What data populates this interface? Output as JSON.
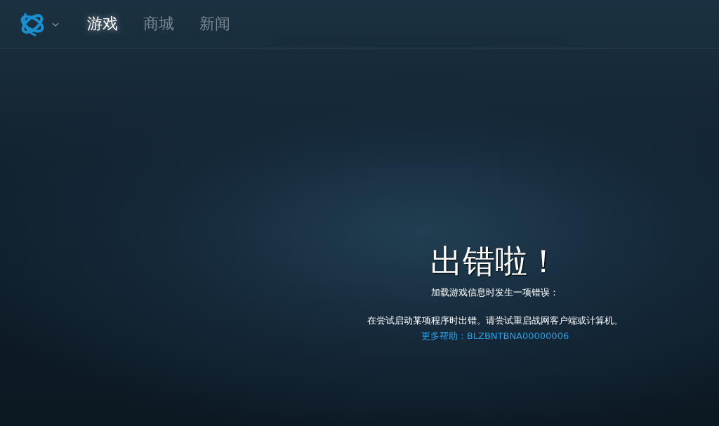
{
  "nav": {
    "tabs": [
      {
        "label": "游戏",
        "selected": true
      },
      {
        "label": "商城",
        "selected": false
      },
      {
        "label": "新闻",
        "selected": false
      }
    ]
  },
  "error": {
    "title": "出错啦！",
    "subtitle": "加载游戏信息时发生一项错误：",
    "message": "在尝试启动某项程序时出错。请尝试重启战网客户端或计算机。",
    "help_link": "更多帮助：BLZBNTBNA00000006"
  }
}
